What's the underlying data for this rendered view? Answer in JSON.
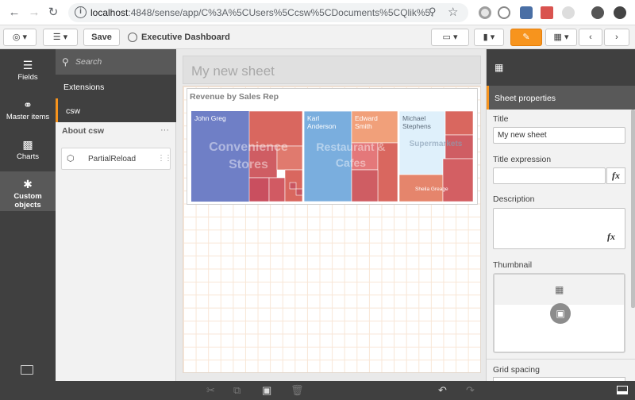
{
  "browser": {
    "url_host": "localhost",
    "url_path": ":4848/sense/app/C%3A%5CUsers%5Ccsw%5CDocuments%5CQlik%5...",
    "icons": [
      "back-arrow-icon",
      "forward-arrow-icon",
      "reload-icon",
      "info-icon",
      "zoom-icon",
      "star-icon"
    ]
  },
  "toolbar": {
    "save_label": "Save",
    "app_title": "Executive Dashboard",
    "edit_color": "#f7941d"
  },
  "leftnav": {
    "items": [
      {
        "label": "Fields",
        "icon": "database-icon"
      },
      {
        "label": "Master items",
        "icon": "link-icon"
      },
      {
        "label": "Charts",
        "icon": "bar-chart-icon"
      },
      {
        "label": "Custom objects",
        "icon": "puzzle-icon",
        "active": true
      }
    ]
  },
  "assets": {
    "search_placeholder": "Search",
    "extensions_label": "Extensions",
    "csw_label": "csw",
    "about_label": "About csw",
    "about_dots": "···",
    "partial_label": "PartialReload"
  },
  "sheet": {
    "title": "My new sheet",
    "chart_title": "Revenue by Sales Rep"
  },
  "treemap": {
    "groups": [
      {
        "name": "Convenience Stores",
        "color": "#d9675f"
      },
      {
        "name": "Restaurant & Cafes",
        "color": "#d9675f"
      },
      {
        "name": "Supermarkets",
        "color": "#d9675f"
      }
    ],
    "reps": [
      {
        "name": "John Greg",
        "color": "#6f7fc6"
      },
      {
        "name": "Karl Anderson",
        "color": "#7aaede"
      },
      {
        "name": "Edward Smith",
        "color": "#f1a07a"
      },
      {
        "name": "Michael Stephens",
        "color": "#dff0fb"
      }
    ],
    "small_label": "Sheila Greage"
  },
  "props": {
    "tab_label": "Sheet properties",
    "title_label": "Title",
    "title_value": "My new sheet",
    "title_expr_label": "Title expression",
    "description_label": "Description",
    "thumbnail_label": "Thumbnail",
    "grid_label": "Grid spacing",
    "fx_label": "fx"
  }
}
